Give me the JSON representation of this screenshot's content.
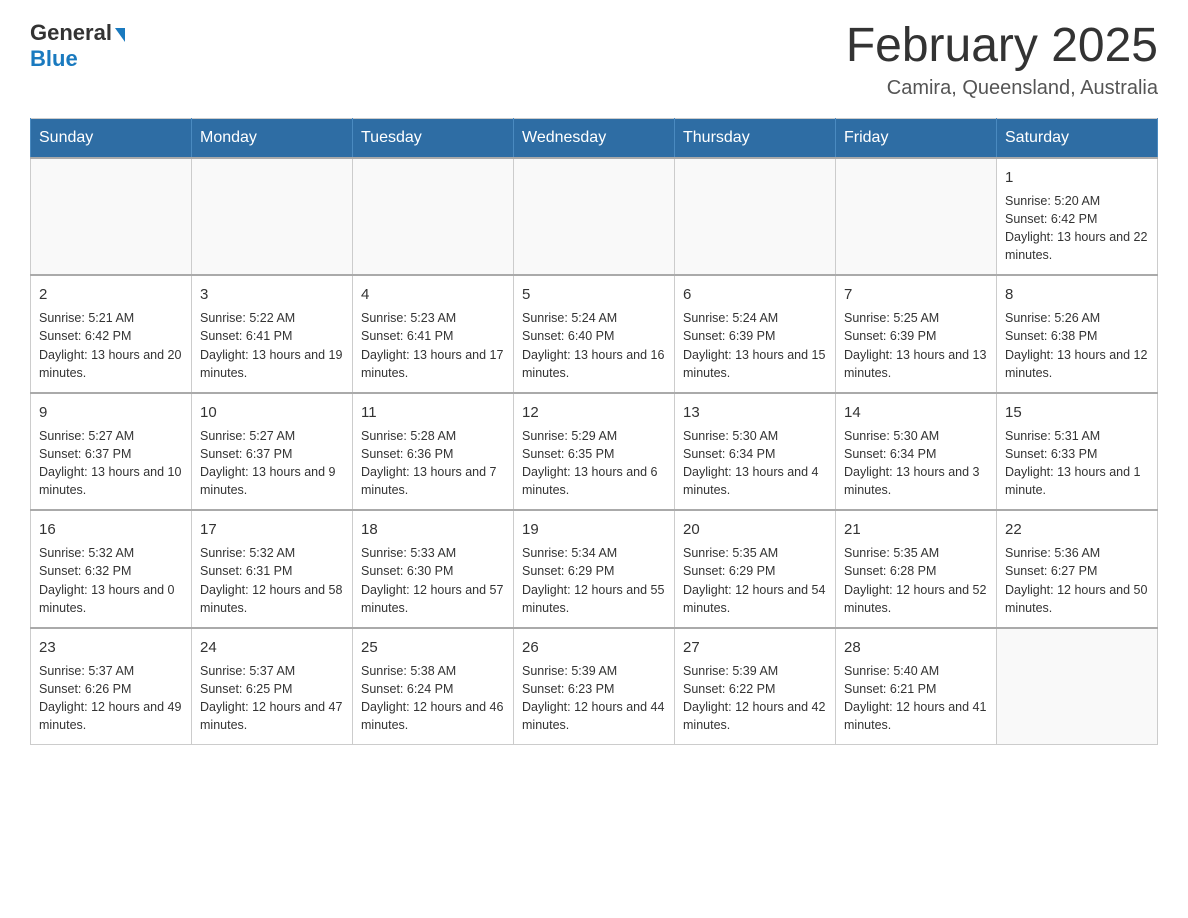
{
  "header": {
    "logo_general": "General",
    "logo_blue": "Blue",
    "title": "February 2025",
    "subtitle": "Camira, Queensland, Australia"
  },
  "days_of_week": [
    "Sunday",
    "Monday",
    "Tuesday",
    "Wednesday",
    "Thursday",
    "Friday",
    "Saturday"
  ],
  "weeks": [
    [
      {
        "day": "",
        "info": ""
      },
      {
        "day": "",
        "info": ""
      },
      {
        "day": "",
        "info": ""
      },
      {
        "day": "",
        "info": ""
      },
      {
        "day": "",
        "info": ""
      },
      {
        "day": "",
        "info": ""
      },
      {
        "day": "1",
        "info": "Sunrise: 5:20 AM\nSunset: 6:42 PM\nDaylight: 13 hours and 22 minutes."
      }
    ],
    [
      {
        "day": "2",
        "info": "Sunrise: 5:21 AM\nSunset: 6:42 PM\nDaylight: 13 hours and 20 minutes."
      },
      {
        "day": "3",
        "info": "Sunrise: 5:22 AM\nSunset: 6:41 PM\nDaylight: 13 hours and 19 minutes."
      },
      {
        "day": "4",
        "info": "Sunrise: 5:23 AM\nSunset: 6:41 PM\nDaylight: 13 hours and 17 minutes."
      },
      {
        "day": "5",
        "info": "Sunrise: 5:24 AM\nSunset: 6:40 PM\nDaylight: 13 hours and 16 minutes."
      },
      {
        "day": "6",
        "info": "Sunrise: 5:24 AM\nSunset: 6:39 PM\nDaylight: 13 hours and 15 minutes."
      },
      {
        "day": "7",
        "info": "Sunrise: 5:25 AM\nSunset: 6:39 PM\nDaylight: 13 hours and 13 minutes."
      },
      {
        "day": "8",
        "info": "Sunrise: 5:26 AM\nSunset: 6:38 PM\nDaylight: 13 hours and 12 minutes."
      }
    ],
    [
      {
        "day": "9",
        "info": "Sunrise: 5:27 AM\nSunset: 6:37 PM\nDaylight: 13 hours and 10 minutes."
      },
      {
        "day": "10",
        "info": "Sunrise: 5:27 AM\nSunset: 6:37 PM\nDaylight: 13 hours and 9 minutes."
      },
      {
        "day": "11",
        "info": "Sunrise: 5:28 AM\nSunset: 6:36 PM\nDaylight: 13 hours and 7 minutes."
      },
      {
        "day": "12",
        "info": "Sunrise: 5:29 AM\nSunset: 6:35 PM\nDaylight: 13 hours and 6 minutes."
      },
      {
        "day": "13",
        "info": "Sunrise: 5:30 AM\nSunset: 6:34 PM\nDaylight: 13 hours and 4 minutes."
      },
      {
        "day": "14",
        "info": "Sunrise: 5:30 AM\nSunset: 6:34 PM\nDaylight: 13 hours and 3 minutes."
      },
      {
        "day": "15",
        "info": "Sunrise: 5:31 AM\nSunset: 6:33 PM\nDaylight: 13 hours and 1 minute."
      }
    ],
    [
      {
        "day": "16",
        "info": "Sunrise: 5:32 AM\nSunset: 6:32 PM\nDaylight: 13 hours and 0 minutes."
      },
      {
        "day": "17",
        "info": "Sunrise: 5:32 AM\nSunset: 6:31 PM\nDaylight: 12 hours and 58 minutes."
      },
      {
        "day": "18",
        "info": "Sunrise: 5:33 AM\nSunset: 6:30 PM\nDaylight: 12 hours and 57 minutes."
      },
      {
        "day": "19",
        "info": "Sunrise: 5:34 AM\nSunset: 6:29 PM\nDaylight: 12 hours and 55 minutes."
      },
      {
        "day": "20",
        "info": "Sunrise: 5:35 AM\nSunset: 6:29 PM\nDaylight: 12 hours and 54 minutes."
      },
      {
        "day": "21",
        "info": "Sunrise: 5:35 AM\nSunset: 6:28 PM\nDaylight: 12 hours and 52 minutes."
      },
      {
        "day": "22",
        "info": "Sunrise: 5:36 AM\nSunset: 6:27 PM\nDaylight: 12 hours and 50 minutes."
      }
    ],
    [
      {
        "day": "23",
        "info": "Sunrise: 5:37 AM\nSunset: 6:26 PM\nDaylight: 12 hours and 49 minutes."
      },
      {
        "day": "24",
        "info": "Sunrise: 5:37 AM\nSunset: 6:25 PM\nDaylight: 12 hours and 47 minutes."
      },
      {
        "day": "25",
        "info": "Sunrise: 5:38 AM\nSunset: 6:24 PM\nDaylight: 12 hours and 46 minutes."
      },
      {
        "day": "26",
        "info": "Sunrise: 5:39 AM\nSunset: 6:23 PM\nDaylight: 12 hours and 44 minutes."
      },
      {
        "day": "27",
        "info": "Sunrise: 5:39 AM\nSunset: 6:22 PM\nDaylight: 12 hours and 42 minutes."
      },
      {
        "day": "28",
        "info": "Sunrise: 5:40 AM\nSunset: 6:21 PM\nDaylight: 12 hours and 41 minutes."
      },
      {
        "day": "",
        "info": ""
      }
    ]
  ]
}
